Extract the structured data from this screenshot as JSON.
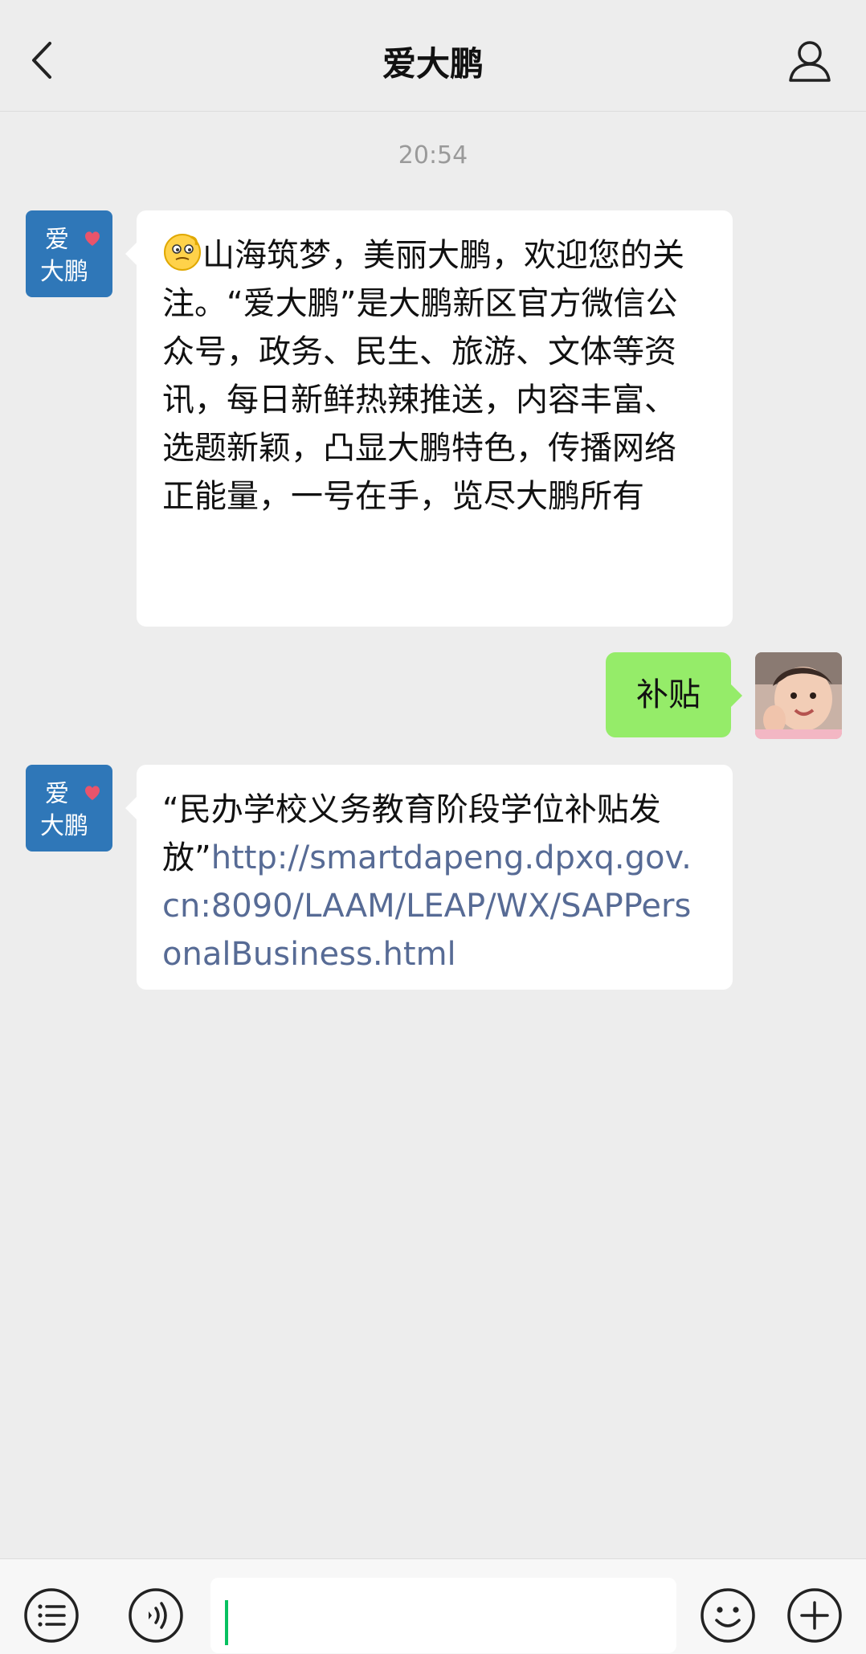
{
  "header": {
    "title": "爱大鹏"
  },
  "chat": {
    "timestamp": "20:54",
    "official_avatar_text": {
      "top": "爱",
      "bottom": "大鹏"
    },
    "messages": [
      {
        "sender": "official",
        "text": "山海筑梦，美丽大鹏，欢迎您的关注。“爱大鹏”是大鹏新区官方微信公众号，政务、民生、旅游、文体等资讯，每日新鲜热辣推送，内容丰富、选题新颖，凸显大鹏特色，传播网络正能量，一号在手，览尽大鹏所有"
      },
      {
        "sender": "user",
        "text": "补贴"
      },
      {
        "sender": "official",
        "text_prefix": "“民办学校义务教育阶段学位补贴发放”",
        "link": "http://smartdapeng.dpxq.gov.cn:8090/LAAM/LEAP/WX/SAPPersonalBusiness.html"
      }
    ]
  },
  "colors": {
    "background": "#ededed",
    "bubble_incoming": "#ffffff",
    "bubble_outgoing": "#95ec69",
    "link": "#576b95",
    "accent": "#07c160"
  },
  "input": {
    "value": ""
  }
}
